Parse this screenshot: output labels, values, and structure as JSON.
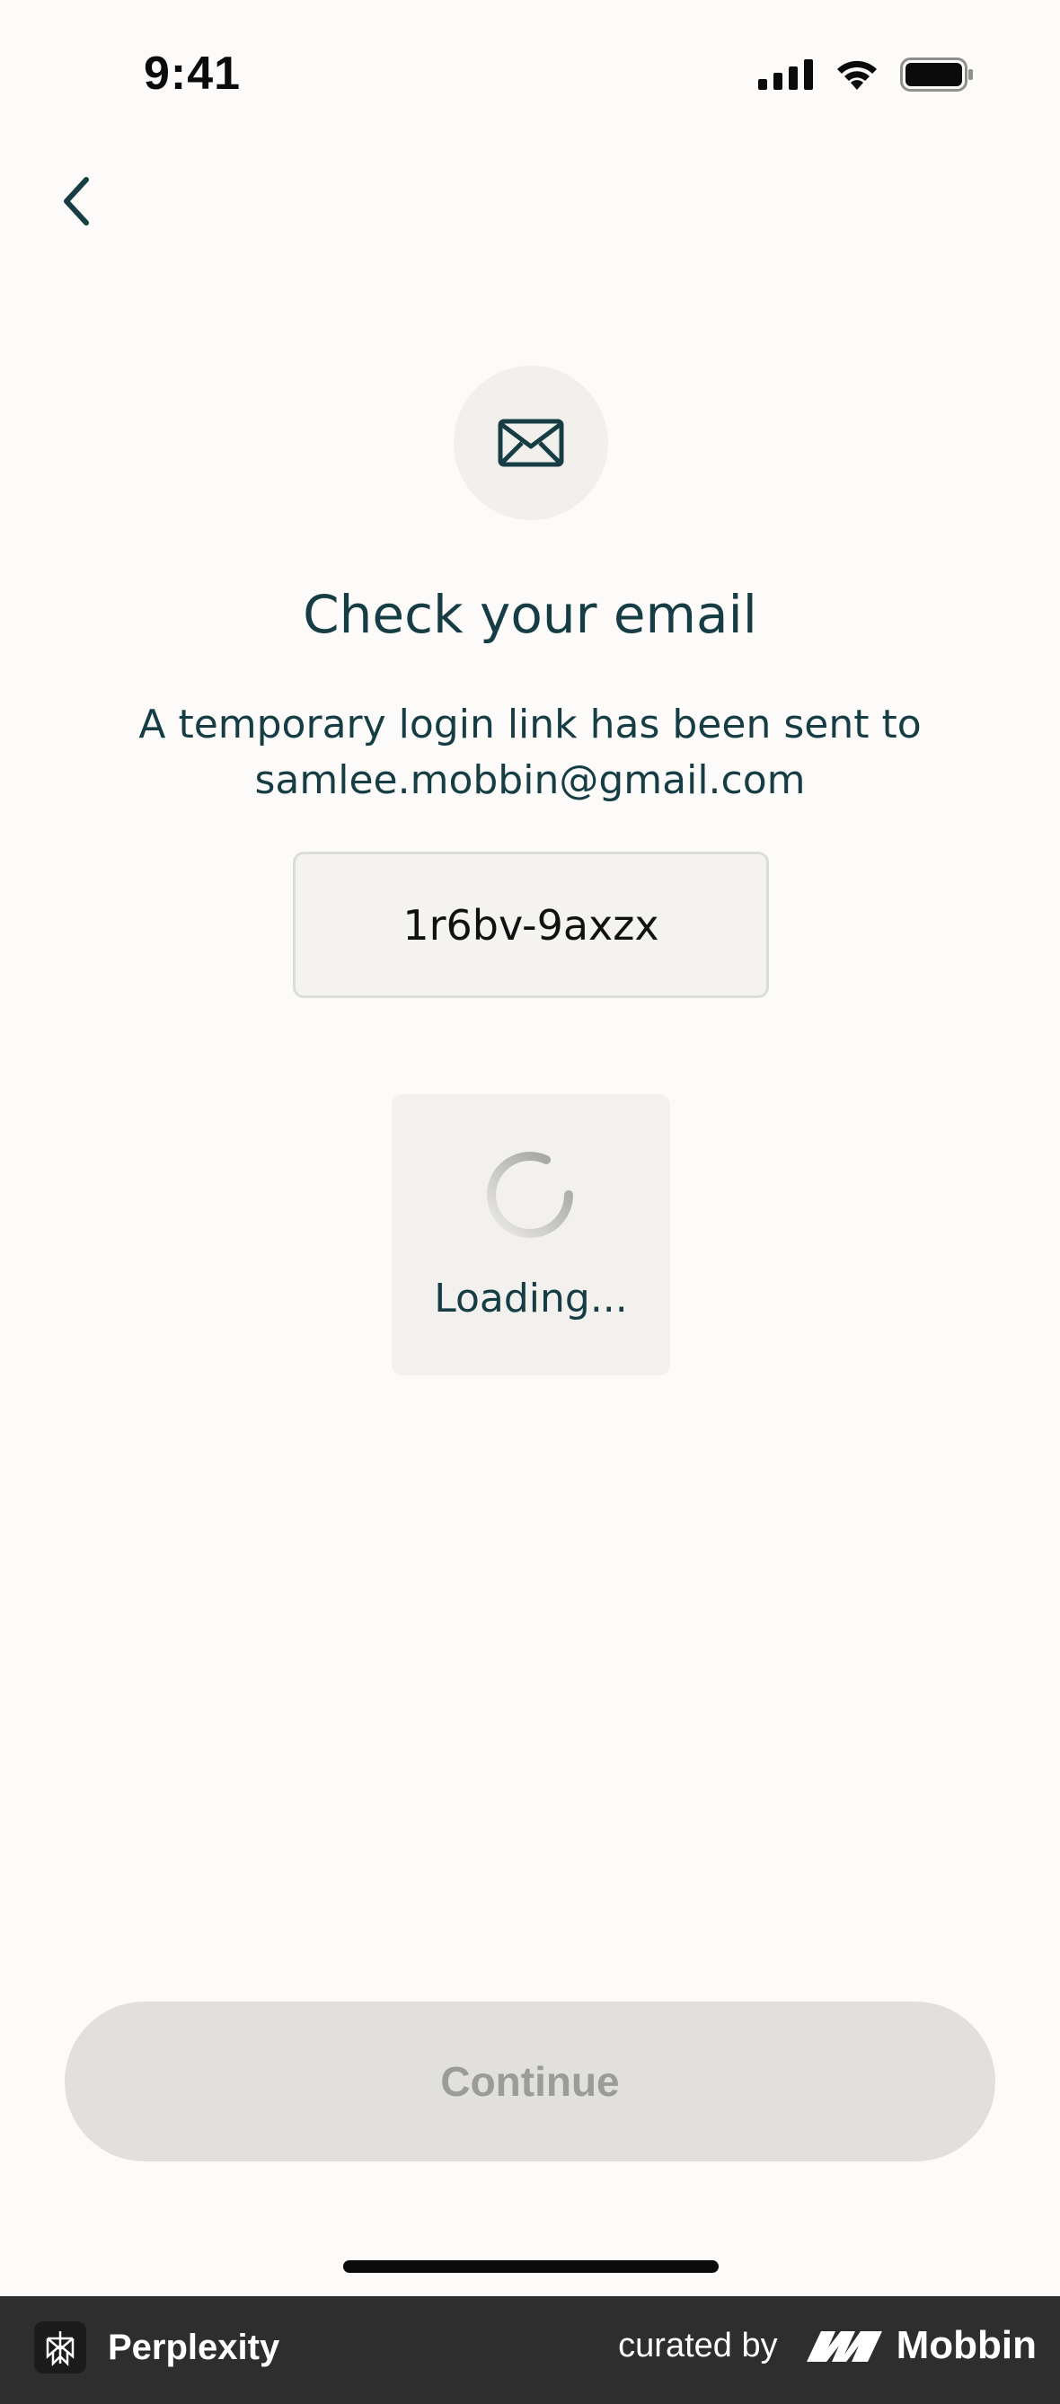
{
  "status_bar": {
    "time": "9:41",
    "icons": [
      "cellular-signal-icon",
      "wifi-icon",
      "battery-icon"
    ]
  },
  "nav": {
    "back_icon": "chevron-left-icon"
  },
  "hero": {
    "icon": "envelope-icon",
    "title": "Check your email",
    "subtitle_line1": "A temporary login link has been sent to",
    "subtitle_line2": "samlee.mobbin@gmail.com"
  },
  "code": {
    "value": "1r6bv-9axzx"
  },
  "loading": {
    "icon": "spinner-icon",
    "label": "Loading..."
  },
  "actions": {
    "continue_label": "Continue"
  },
  "footer": {
    "app_icon": "perplexity-logo-icon",
    "app_name": "Perplexity",
    "curated_by": "curated by",
    "brand_icon": "mobbin-logo-icon",
    "brand_name": "Mobbin"
  },
  "colors": {
    "background": "#fcfbf9",
    "text_primary": "#163c44",
    "button_disabled_bg": "#e1e0de",
    "button_disabled_text": "#9b9b98",
    "footer_bg": "#2e2e2e"
  }
}
